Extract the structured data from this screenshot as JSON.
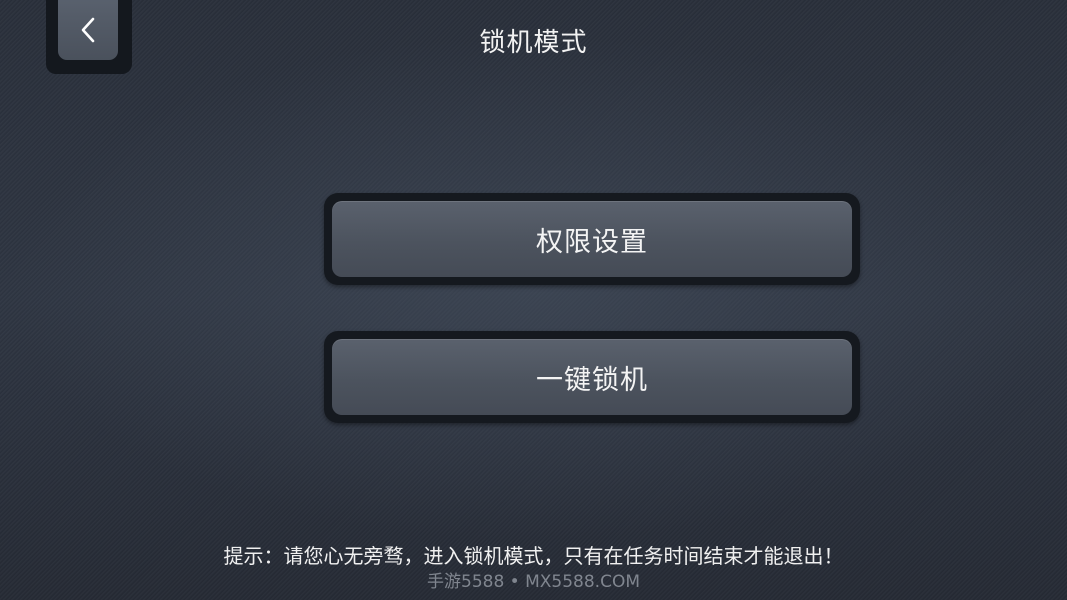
{
  "header": {
    "title": "锁机模式",
    "back_icon": "chevron-left-icon"
  },
  "menu": {
    "items": [
      {
        "label": "权限设置"
      },
      {
        "label": "一键锁机"
      }
    ]
  },
  "footer": {
    "hint": "提示：请您心无旁骛，进入锁机模式，只有在任务时间结束才能退出！",
    "watermark": "手游5588 • MX5588.COM"
  }
}
